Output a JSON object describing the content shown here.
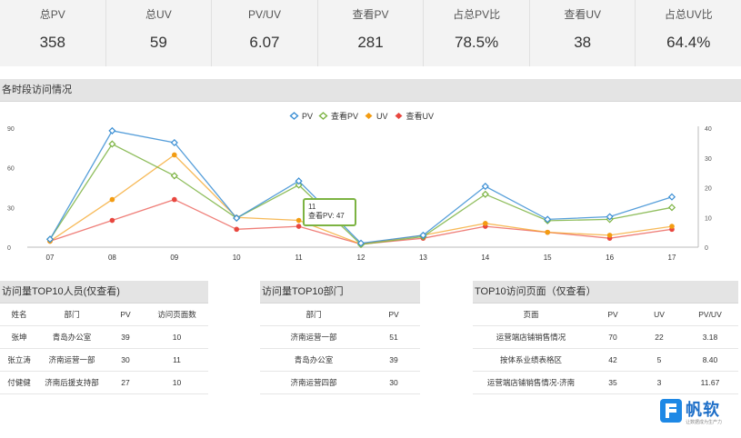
{
  "kpis": [
    {
      "label": "总PV",
      "value": "358"
    },
    {
      "label": "总UV",
      "value": "59"
    },
    {
      "label": "PV/UV",
      "value": "6.07"
    },
    {
      "label": "查看PV",
      "value": "281"
    },
    {
      "label": "占总PV比",
      "value": "78.5%"
    },
    {
      "label": "查看UV",
      "value": "38"
    },
    {
      "label": "占总UV比",
      "value": "64.4%"
    }
  ],
  "chart_section": {
    "title": "各时段访问情况"
  },
  "chart_data": {
    "type": "line",
    "categories": [
      "07",
      "08",
      "09",
      "10",
      "11",
      "12",
      "13",
      "14",
      "15",
      "16",
      "17"
    ],
    "series": [
      {
        "name": "PV",
        "axis": "left",
        "color": "#3a8ed4",
        "values": [
          6,
          88,
          79,
          22,
          50,
          3,
          9,
          46,
          21,
          23,
          38
        ]
      },
      {
        "name": "查看PV",
        "axis": "left",
        "color": "#7cb342",
        "values": [
          6,
          78,
          54,
          22,
          47,
          2,
          8,
          40,
          20,
          21,
          30
        ]
      },
      {
        "name": "UV",
        "axis": "right",
        "color": "#f39c12",
        "values": [
          2,
          16,
          31,
          10,
          9,
          1,
          4,
          8,
          5,
          4,
          7
        ]
      },
      {
        "name": "查看UV",
        "axis": "right",
        "color": "#e8473f",
        "values": [
          2,
          9,
          16,
          6,
          7,
          1,
          3,
          7,
          5,
          3,
          6
        ]
      }
    ],
    "y_left": {
      "ticks": [
        "0",
        "30",
        "60",
        "90"
      ],
      "range": [
        0,
        90
      ]
    },
    "y_right": {
      "ticks": [
        "0",
        "10",
        "20",
        "30",
        "40"
      ],
      "range": [
        0,
        40
      ]
    },
    "legend": "top-center",
    "grid": false
  },
  "tooltip": {
    "line1": "11",
    "line2": "查看PV: 47"
  },
  "table_users": {
    "title": "访问量TOP10人员(仅查看)",
    "headers": [
      "姓名",
      "部门",
      "PV",
      "访问页面数"
    ],
    "rows": [
      [
        "张坤",
        "青岛办公室",
        "39",
        "10"
      ],
      [
        "张立涛",
        "济南运营一部",
        "30",
        "11"
      ],
      [
        "付健健",
        "济南后援支持部",
        "27",
        "10"
      ]
    ]
  },
  "table_depts": {
    "title": "访问量TOP10部门",
    "headers": [
      "部门",
      "PV"
    ],
    "rows": [
      [
        "济南运营一部",
        "51"
      ],
      [
        "青岛办公室",
        "39"
      ],
      [
        "济南运营四部",
        "30"
      ]
    ]
  },
  "table_pages": {
    "title": "TOP10访问页面（仅查看）",
    "headers": [
      "页面",
      "PV",
      "UV",
      "PV/UV"
    ],
    "rows": [
      [
        "运营端店铺销售情况",
        "70",
        "22",
        "3.18"
      ],
      [
        "按体系业绩表格区",
        "42",
        "5",
        "8.40"
      ],
      [
        "运营端店铺销售情况-济南",
        "35",
        "3",
        "11.67"
      ]
    ]
  },
  "logo": {
    "name": "帆软",
    "tagline": "让数据成为生产力"
  }
}
